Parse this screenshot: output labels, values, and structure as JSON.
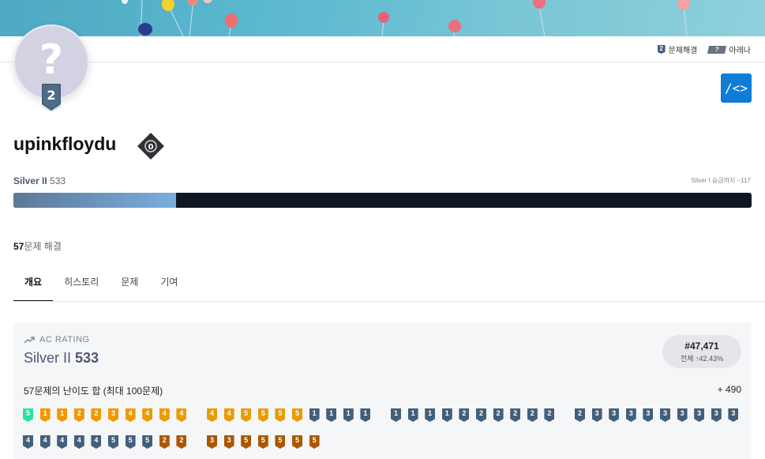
{
  "top_links": {
    "problems": "문제해결",
    "problems_badge": "2",
    "arena": "아레나",
    "arena_badge": "?"
  },
  "avatar": {
    "glyph": "?",
    "tier_number": "2"
  },
  "code_button": "/<>",
  "user": {
    "handle": "upinkfloydu",
    "class_number": "0"
  },
  "tier": {
    "name": "Silver II",
    "rating": "533",
    "next_text": "Silver I 승급까지 −117",
    "progress_percent": 22
  },
  "solved": {
    "count": "57",
    "label": "문제 해결"
  },
  "tabs": [
    "개요",
    "히스토리",
    "문제",
    "기여"
  ],
  "ac_rating": {
    "label": "AC RATING",
    "tier_name": "Silver II",
    "rating": "533",
    "rank": "#47,471",
    "rank_detail": "전체 ↑42.43%",
    "sum_label": "57문제의 난이도 합 (최대 100문제)",
    "bonus": "+ 490"
  },
  "badges_row1": [
    {
      "t": "p",
      "n": "5"
    },
    {
      "t": "g",
      "n": "1"
    },
    {
      "t": "g",
      "n": "1"
    },
    {
      "t": "g",
      "n": "2"
    },
    {
      "t": "g",
      "n": "2"
    },
    {
      "t": "g",
      "n": "3"
    },
    {
      "t": "g",
      "n": "4"
    },
    {
      "t": "g",
      "n": "4"
    },
    {
      "t": "g",
      "n": "4"
    },
    {
      "t": "g",
      "n": "4"
    },
    {
      "t": "g",
      "n": "4"
    },
    {
      "t": "g",
      "n": "4"
    },
    {
      "t": "g",
      "n": "5"
    },
    {
      "t": "g",
      "n": "5"
    },
    {
      "t": "g",
      "n": "5"
    },
    {
      "t": "g",
      "n": "5"
    },
    {
      "t": "s",
      "n": "1"
    },
    {
      "t": "s",
      "n": "1"
    },
    {
      "t": "s",
      "n": "1"
    },
    {
      "t": "s",
      "n": "1"
    },
    {
      "t": "s",
      "n": "1"
    },
    {
      "t": "s",
      "n": "1"
    },
    {
      "t": "s",
      "n": "1"
    },
    {
      "t": "s",
      "n": "1"
    },
    {
      "t": "s",
      "n": "2"
    },
    {
      "t": "s",
      "n": "2"
    },
    {
      "t": "s",
      "n": "2"
    },
    {
      "t": "s",
      "n": "2"
    },
    {
      "t": "s",
      "n": "2"
    },
    {
      "t": "s",
      "n": "2"
    },
    {
      "t": "s",
      "n": "2"
    },
    {
      "t": "s",
      "n": "3"
    },
    {
      "t": "s",
      "n": "3"
    },
    {
      "t": "s",
      "n": "3"
    },
    {
      "t": "s",
      "n": "3"
    },
    {
      "t": "s",
      "n": "3"
    },
    {
      "t": "s",
      "n": "3"
    },
    {
      "t": "s",
      "n": "3"
    },
    {
      "t": "s",
      "n": "3"
    },
    {
      "t": "s",
      "n": "3"
    }
  ],
  "badges_row2": [
    {
      "t": "s",
      "n": "4"
    },
    {
      "t": "s",
      "n": "4"
    },
    {
      "t": "s",
      "n": "4"
    },
    {
      "t": "s",
      "n": "4"
    },
    {
      "t": "s",
      "n": "4"
    },
    {
      "t": "s",
      "n": "5"
    },
    {
      "t": "s",
      "n": "5"
    },
    {
      "t": "s",
      "n": "5"
    },
    {
      "t": "b",
      "n": "2"
    },
    {
      "t": "b",
      "n": "2"
    },
    {
      "t": "b",
      "n": "3"
    },
    {
      "t": "b",
      "n": "3"
    },
    {
      "t": "b",
      "n": "5"
    },
    {
      "t": "b",
      "n": "5"
    },
    {
      "t": "b",
      "n": "5"
    },
    {
      "t": "b",
      "n": "5"
    },
    {
      "t": "b",
      "n": "5"
    }
  ]
}
